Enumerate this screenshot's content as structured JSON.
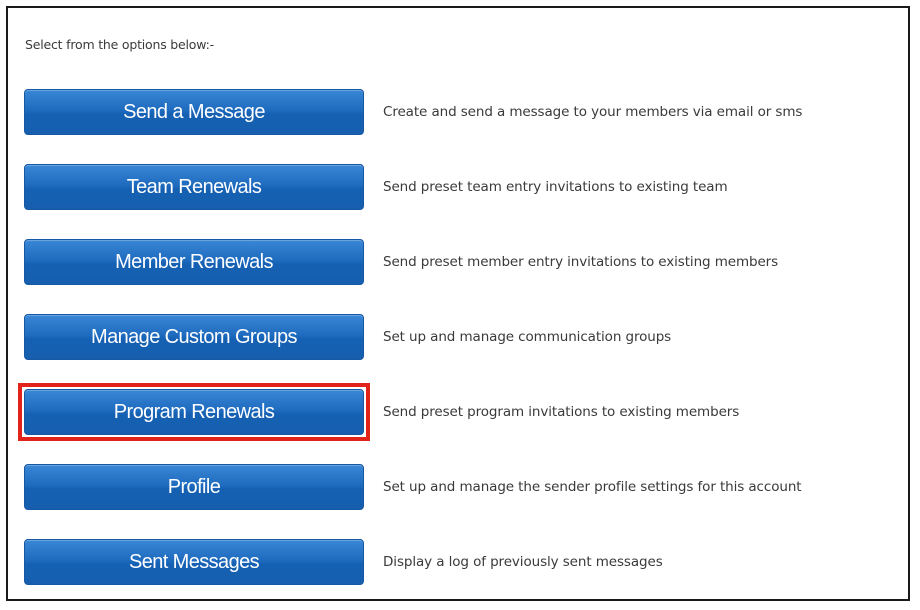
{
  "intro_text": "Select from the options below:-",
  "highlight_color": "#e2231a",
  "button_color": "#1f6cc0",
  "options": [
    {
      "label": "Send a Message",
      "description": "Create and send a message to your members via email or sms",
      "highlighted": false
    },
    {
      "label": "Team Renewals",
      "description": "Send preset team entry invitations to existing team",
      "highlighted": false
    },
    {
      "label": "Member Renewals",
      "description": "Send preset member entry invitations to existing members",
      "highlighted": false
    },
    {
      "label": "Manage Custom Groups",
      "description": "Set up and manage communication groups",
      "highlighted": false
    },
    {
      "label": "Program Renewals",
      "description": "Send preset program invitations to existing members",
      "highlighted": true
    },
    {
      "label": "Profile",
      "description": "Set up and manage the sender profile settings for this account",
      "highlighted": false
    },
    {
      "label": "Sent Messages",
      "description": "Display a log of previously sent messages",
      "highlighted": false
    }
  ]
}
